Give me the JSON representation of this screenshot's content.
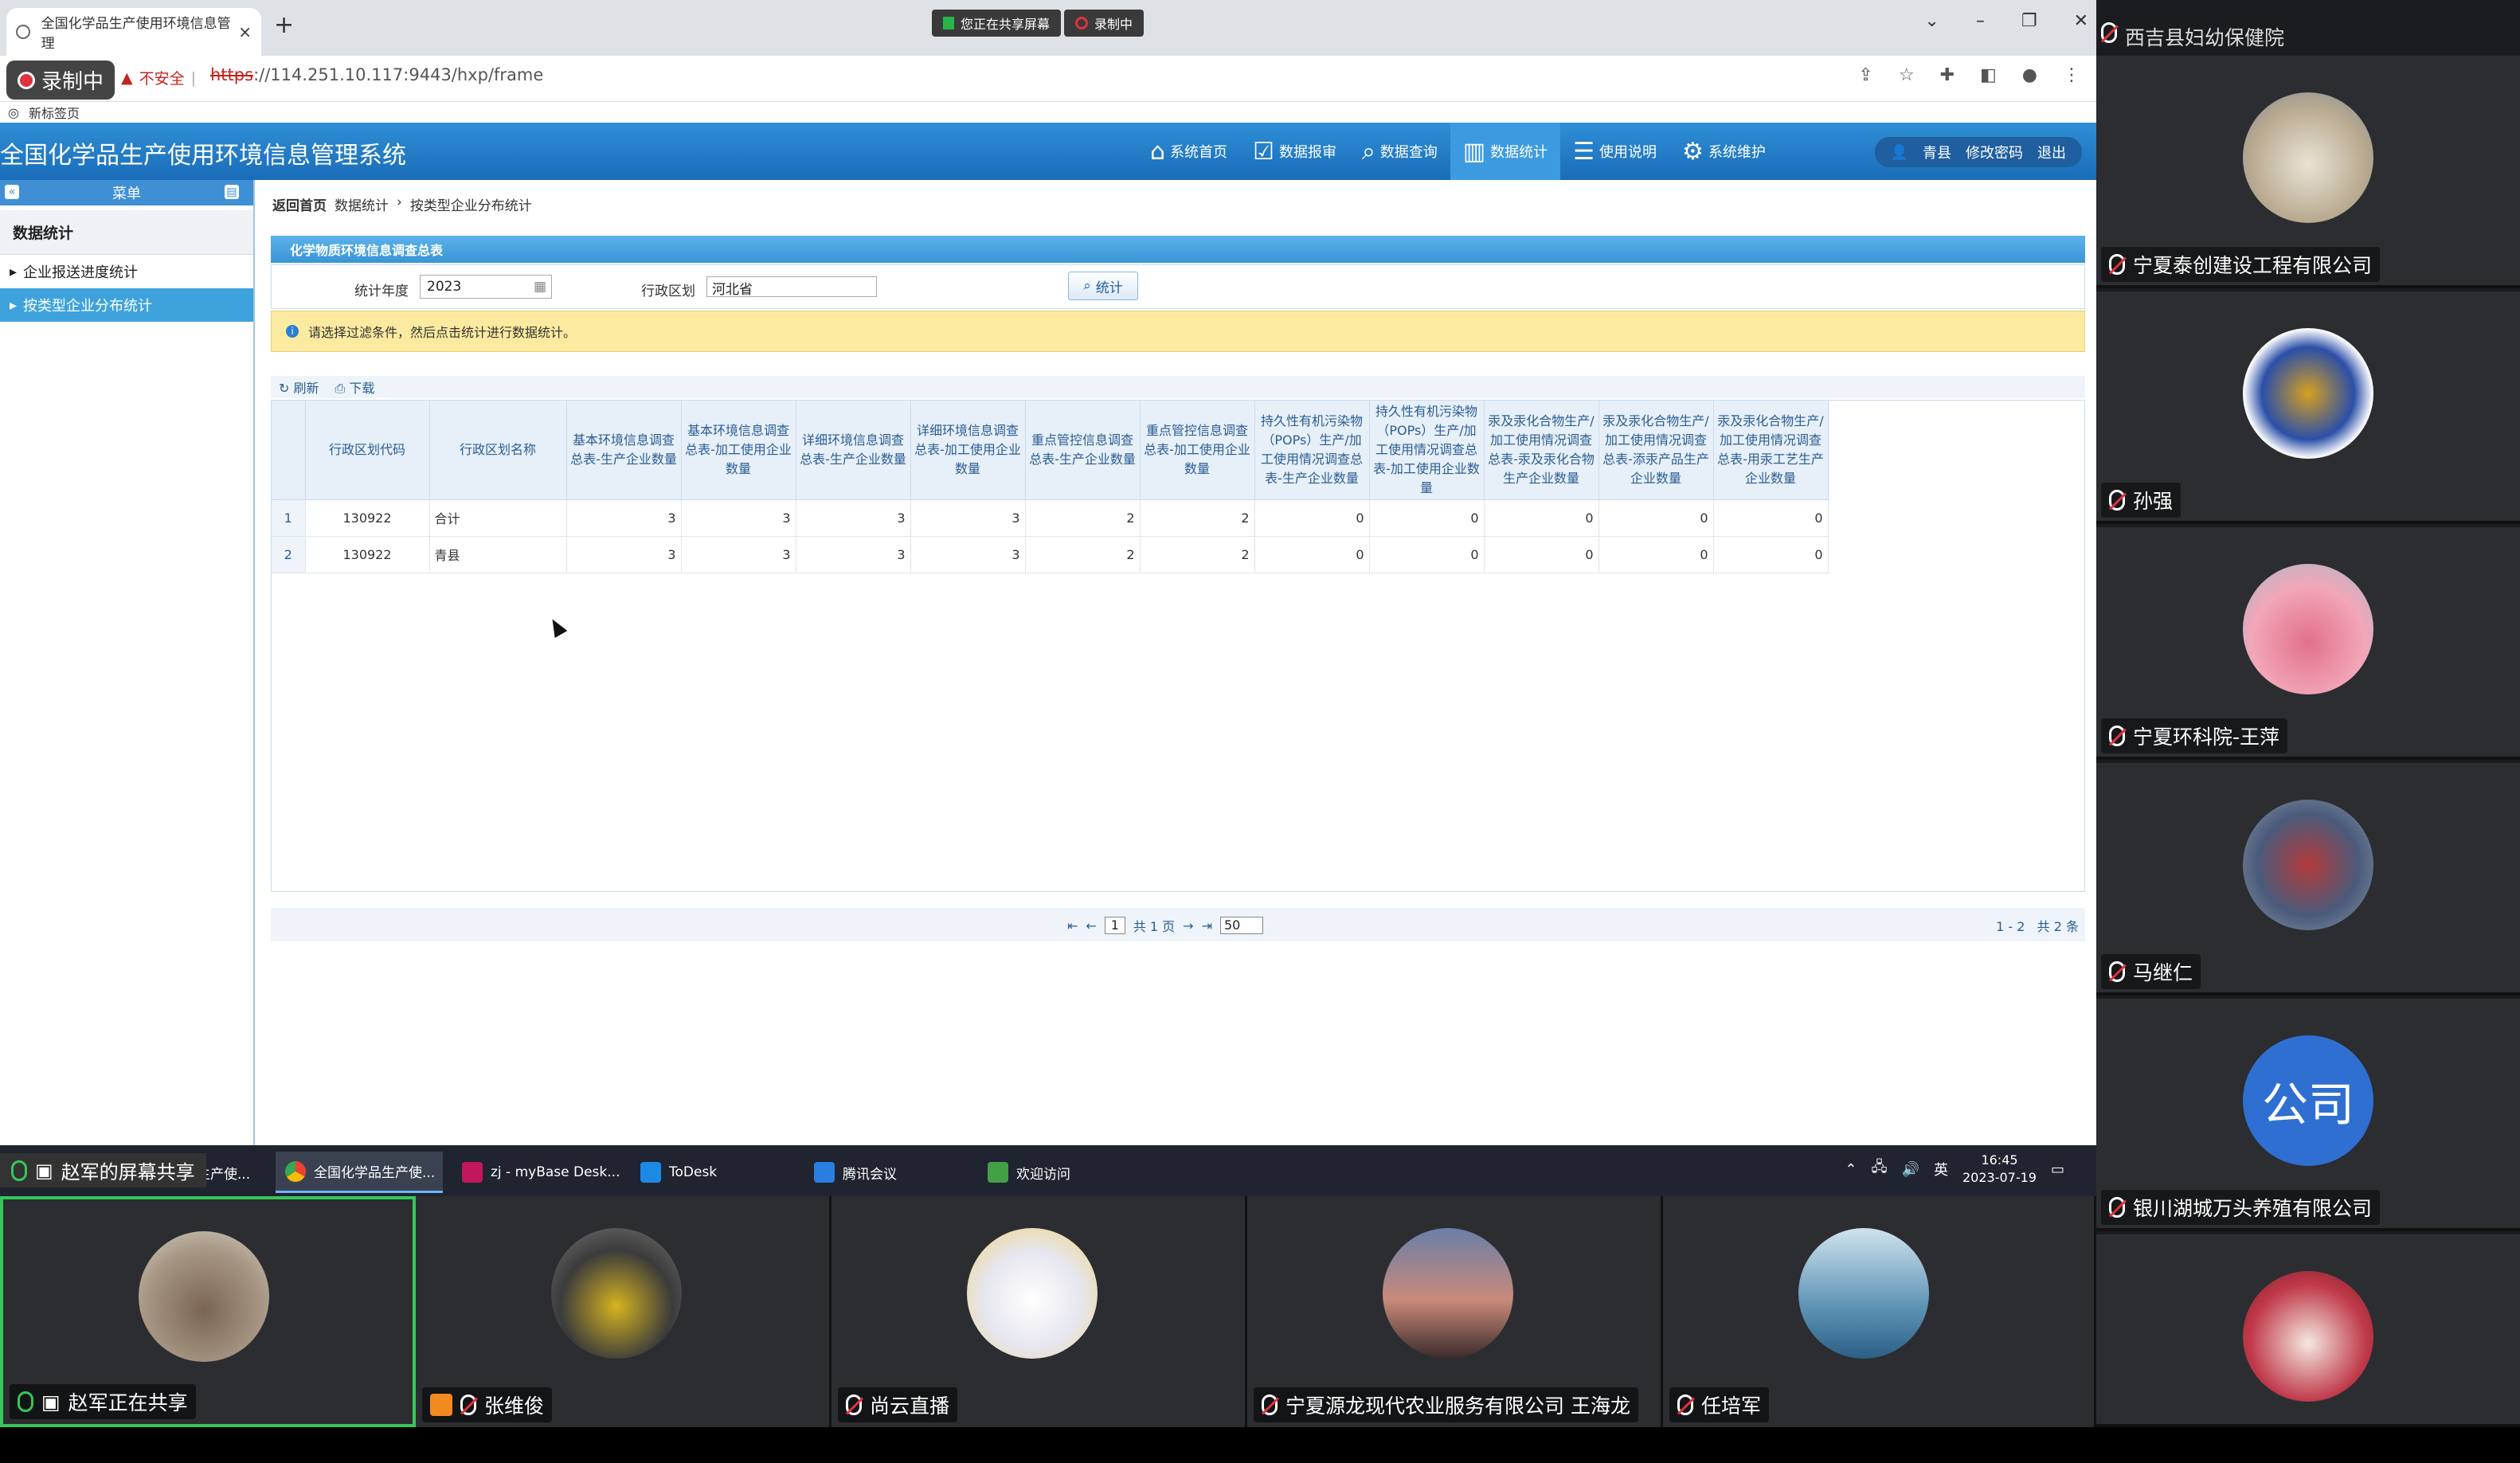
{
  "browser": {
    "tab_title": "全国化学品生产使用环境信息管理",
    "tab_close": "×",
    "new_tab": "+",
    "share_indicator": "您正在共享屏幕",
    "recording_indicator": "录制中",
    "record_badge": "录制中",
    "insecure_label": "不安全",
    "url_scheme": "https",
    "url_rest": "://114.251.10.117:9443/hxp/frame",
    "bookmark": "新标签页"
  },
  "app": {
    "title": "全国化学品生产使用环境信息管理系统",
    "nav": [
      {
        "label": "系统首页",
        "icon": "⌂"
      },
      {
        "label": "数据报审",
        "icon": "☑"
      },
      {
        "label": "数据查询",
        "icon": "⌕"
      },
      {
        "label": "数据统计",
        "icon": "▥"
      },
      {
        "label": "使用说明",
        "icon": "☰"
      },
      {
        "label": "系统维护",
        "icon": "⚙"
      }
    ],
    "user": {
      "name": "青县",
      "change_password": "修改密码",
      "logout": "退出"
    }
  },
  "sidebar": {
    "header": "菜单",
    "section": "数据统计",
    "items": [
      {
        "label": "企业报送进度统计"
      },
      {
        "label": "按类型企业分布统计"
      }
    ]
  },
  "breadcrumb": {
    "home": "返回首页",
    "level1": "数据统计",
    "level2": "按类型企业分布统计"
  },
  "panel": {
    "title": "化学物质环境信息调查总表"
  },
  "filter": {
    "year_label": "统计年度",
    "year_value": "2023",
    "region_label": "行政区划",
    "region_value": "河北省",
    "submit": "统计"
  },
  "notice": "请选择过滤条件，然后点击统计进行数据统计。",
  "grid": {
    "toolbar": {
      "refresh": "刷新",
      "download": "下载"
    },
    "headers": [
      "行政区划代码",
      "行政区划名称",
      "基本环境信息调查总表-生产企业数量",
      "基本环境信息调查总表-加工使用企业数量",
      "详细环境信息调查总表-生产企业数量",
      "详细环境信息调查总表-加工使用企业数量",
      "重点管控信息调查总表-生产企业数量",
      "重点管控信息调查总表-加工使用企业数量",
      "持久性有机污染物（POPs）生产/加工使用情况调查总表-生产企业数量",
      "持久性有机污染物（POPs）生产/加工使用情况调查总表-加工使用企业数量",
      "汞及汞化合物生产/加工使用情况调查总表-汞及汞化合物生产企业数量",
      "汞及汞化合物生产/加工使用情况调查总表-添汞产品生产企业数量",
      "汞及汞化合物生产/加工使用情况调查总表-用汞工艺生产企业数量"
    ],
    "rows": [
      {
        "n": "1",
        "code": "130922",
        "name": "合计",
        "v": [
          "3",
          "3",
          "3",
          "3",
          "2",
          "2",
          "0",
          "0",
          "0",
          "0",
          "0"
        ]
      },
      {
        "n": "2",
        "code": "130922",
        "name": "青县",
        "v": [
          "3",
          "3",
          "3",
          "3",
          "2",
          "2",
          "0",
          "0",
          "0",
          "0",
          "0"
        ]
      }
    ],
    "pager": {
      "page": "1",
      "total_pages": "共 1 页",
      "page_size": "50",
      "range": "1 - 2",
      "total": "共 2 条"
    }
  },
  "taskbar": {
    "items": [
      {
        "label": "全国化学品生产使..."
      },
      {
        "label": "全国化学品生产使..."
      },
      {
        "label": "zj - myBase Desk..."
      },
      {
        "label": "ToDesk"
      },
      {
        "label": "腾讯会议"
      },
      {
        "label": "欢迎访问"
      }
    ],
    "ime": "英",
    "time": "16:45",
    "date": "2023-07-19"
  },
  "meeting": {
    "screen_share_label": "赵军的屏幕共享",
    "bottom": [
      {
        "name": "赵军正在共享"
      },
      {
        "name": "张维俊"
      },
      {
        "name": "尚云直播"
      },
      {
        "name": "宁夏源龙现代农业服务有限公司 王海龙"
      },
      {
        "name": "任培军"
      }
    ],
    "right_top": "西吉县妇幼保健院",
    "right": [
      {
        "name": "宁夏泰创建设工程有限公司"
      },
      {
        "name": "孙强"
      },
      {
        "name": "宁夏环科院-王萍"
      },
      {
        "name": "马继仁"
      },
      {
        "name": "银川湖城万头养殖有限公司",
        "avatar_text": "公司"
      },
      {
        "name": ""
      }
    ]
  }
}
